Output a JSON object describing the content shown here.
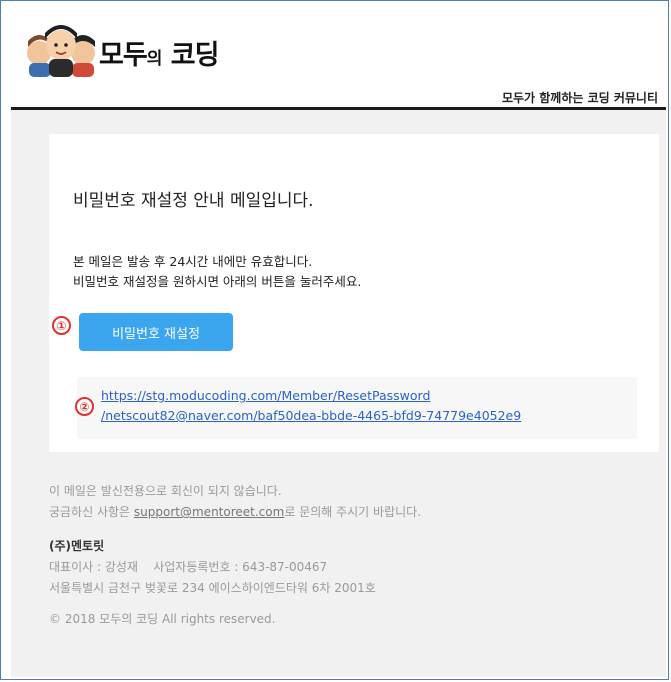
{
  "brand": {
    "logo_text_main": "모두",
    "logo_text_small": "의",
    "logo_text_end": "코딩",
    "tagline": "모두가 함께하는 코딩 커뮤니티"
  },
  "email": {
    "title": "비밀번호 재설정 안내 메일입니다.",
    "desc_line1": "본 메일은 발송 후 24시간 내에만 유효합니다.",
    "desc_line2": "비밀번호 재설정을 원하시면 아래의 버튼을 눌러주세요.",
    "marker_1": "①",
    "marker_2": "②",
    "button_label": "비밀번호 재설정",
    "link_line1": "https://stg.moducoding.com/Member/ResetPassword",
    "link_line2": "/netscout82@naver.com/baf50dea-bbde-4465-bfd9-74779e4052e9"
  },
  "footer": {
    "noreply": "이 메일은 발신전용으로 회신이 되지 않습니다.",
    "contact_prefix": "궁금하신 사항은 ",
    "contact_email": "support@mentoreet.com",
    "contact_suffix": "로 문의해 주시기 바랍니다.",
    "company_name": "(주)멘토릿",
    "ceo": "대표이사 : 강성재",
    "biz_number": "사업자등록번호 : 643-87-00467",
    "address": "서울특별시 금천구 벚꽃로 234 에이스하이엔드타워 6차 2001호",
    "copyright": "© 2018 모두의 코딩 All rights reserved."
  },
  "colors": {
    "button_bg": "#3ba6ee",
    "link": "#2a62c8",
    "marker": "#e03030",
    "frame_border": "#4a7fbf"
  },
  "icons": {
    "logo": "people-faces-logo"
  }
}
